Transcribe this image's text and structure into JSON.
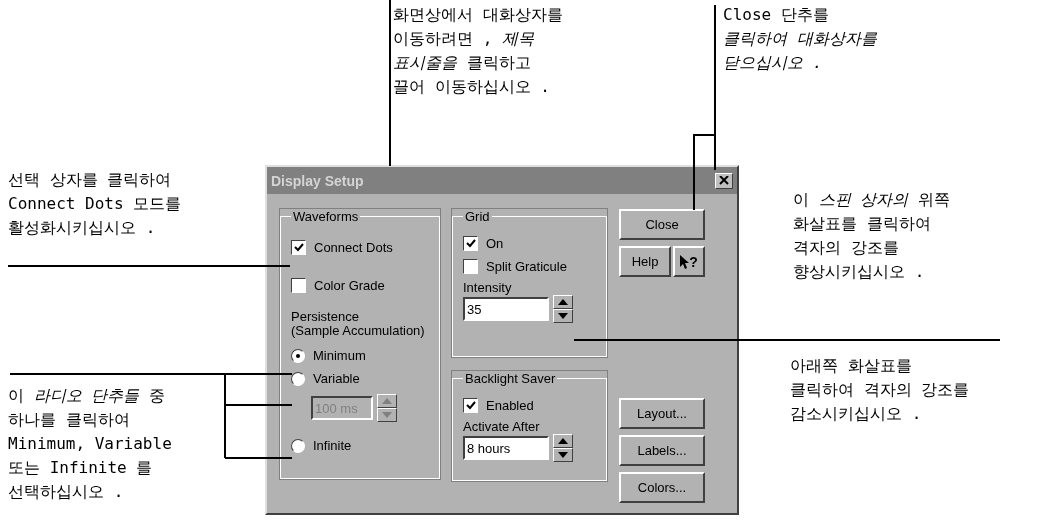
{
  "callouts": [
    {
      "lines": [
        "화면상에서 대화상자를",
        "이동하려면 , *제목*",
        "*표시줄을* 클릭하고",
        "끌어 이동하십시오 ."
      ]
    },
    {
      "lines": [
        "Close 단추를",
        "*클릭하여 대화상자를*",
        "*닫으십시오 .*"
      ]
    },
    {
      "lines": [
        "선택 상자를 클릭하여",
        "Connect Dots 모드를",
        "활성화시키십시오 ."
      ]
    },
    {
      "lines": [
        "이 *스핀 상자의* 위쪽",
        "화살표를 클릭하여",
        "격자의 강조를",
        "향상시키십시오 ."
      ]
    },
    {
      "lines": [
        "아래쪽 화살표를",
        "클릭하여 격자의 강조를",
        "감소시키십시오 ."
      ]
    },
    {
      "lines": [
        "이 *라디오 단추들* 중",
        "하나를 클릭하여",
        "Minimum, Variable",
        "또는 Infinite 를",
        "선택하십시오 ."
      ]
    }
  ],
  "dialog": {
    "title": "Display Setup",
    "waveforms": {
      "label": "Waveforms",
      "checkboxes": [
        {
          "label": "Connect Dots",
          "checked": true
        },
        {
          "label": "Color Grade",
          "checked": false
        }
      ],
      "persistence_label": [
        "Persistence",
        "(Sample Accumulation)"
      ],
      "items": [
        {
          "kind": "radio",
          "label": "Minimum",
          "selected": true
        },
        {
          "kind": "radio",
          "label": "Variable",
          "selected": false
        },
        {
          "kind": "spin",
          "value": "100 ms",
          "disabled": true
        },
        {
          "kind": "radio",
          "label": "Infinite",
          "selected": false
        }
      ]
    },
    "grid": {
      "label": "Grid",
      "checkboxes": [
        {
          "label": "On",
          "checked": true
        },
        {
          "label": "Split Graticule",
          "checked": false
        }
      ],
      "spin_label": "Intensity",
      "spin_value": "35"
    },
    "backlight": {
      "label": "Backlight Saver",
      "checkboxes": [
        {
          "label": "Enabled",
          "checked": true
        }
      ],
      "spin_label": "Activate After",
      "spin_value": "8 hours"
    },
    "top_buttons": [
      "Close",
      "Help"
    ],
    "context_help": "?",
    "bottom_buttons": [
      "Layout...",
      "Labels...",
      "Colors..."
    ]
  }
}
